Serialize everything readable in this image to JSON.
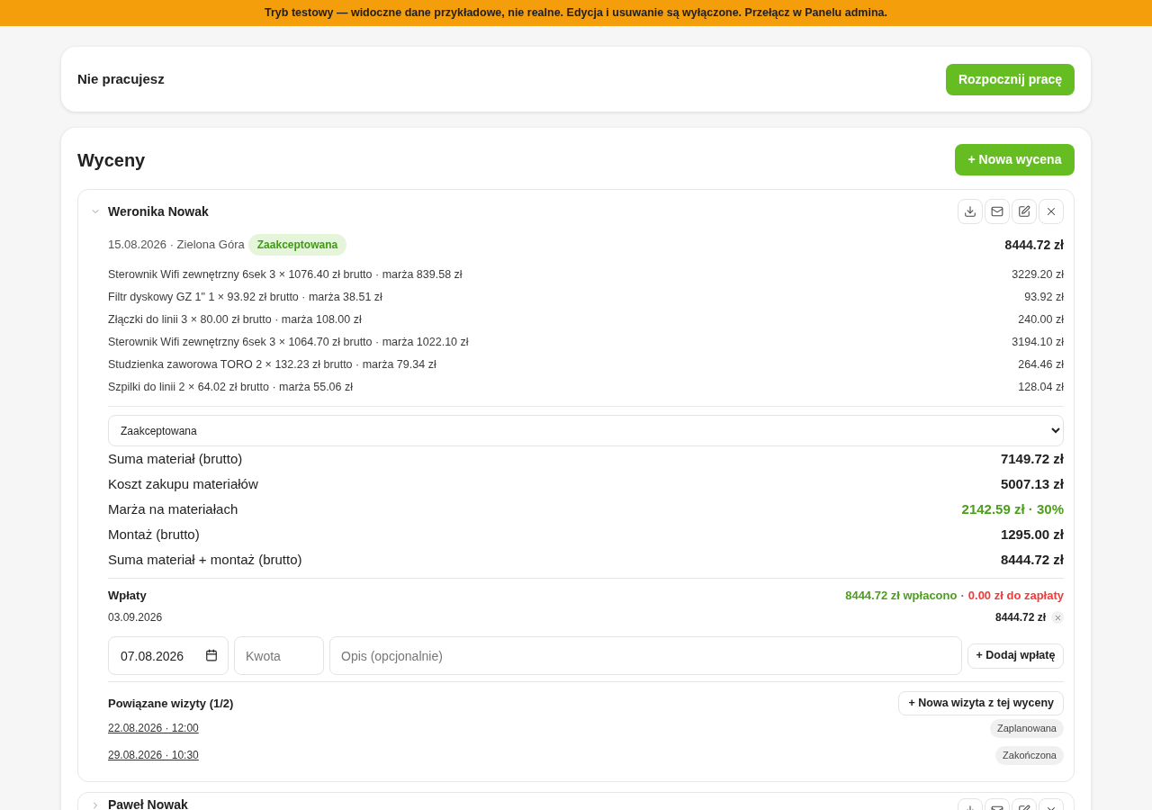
{
  "banner": {
    "text": "Tryb testowy — widoczne dane przykładowe, nie realne. Edycja i usuwanie są wyłączone. Przełącz w Panelu admina."
  },
  "work_status": {
    "label": "Nie pracujesz",
    "start_button": "Rozpocznij pracę"
  },
  "quotes_section": {
    "title": "Wyceny",
    "new_button": "+ Nowa wycena"
  },
  "quotes": [
    {
      "client": "Weronika Nowak",
      "expanded": true,
      "date_location": "15.08.2026 · Zielona Góra",
      "status_badge": {
        "text": "Zaakceptowana",
        "kind": "success"
      },
      "total": "8444.72 zł",
      "items": [
        {
          "description": "Sterownik Wifi zewnętrzny 6sek 3 × 1076.40 zł brutto · marża 839.58 zł",
          "amount": "3229.20 zł"
        },
        {
          "description": "Filtr dyskowy GZ 1\" 1 × 93.92 zł brutto · marża 38.51 zł",
          "amount": "93.92 zł"
        },
        {
          "description": "Złączki do linii 3 × 80.00 zł brutto · marża 108.00 zł",
          "amount": "240.00 zł"
        },
        {
          "description": "Sterownik Wifi zewnętrzny 6sek 3 × 1064.70 zł brutto · marża 1022.10 zł",
          "amount": "3194.10 zł"
        },
        {
          "description": "Studzienka zaworowa TORO 2 × 132.23 zł brutto · marża 79.34 zł",
          "amount": "264.46 zł"
        },
        {
          "description": "Szpilki do linii 2 × 64.02 zł brutto · marża 55.06 zł",
          "amount": "128.04 zł"
        }
      ],
      "status_select": {
        "value": "Zaakceptowana"
      },
      "summary": [
        {
          "label": "Suma materiał (brutto)",
          "value": "7149.72 zł",
          "kind": "plain"
        },
        {
          "label": "Koszt zakupu materiałów",
          "value": "5007.13 zł",
          "kind": "plain"
        },
        {
          "label": "Marża na materiałach",
          "value": "2142.59 zł · 30%",
          "kind": "positive"
        },
        {
          "label": "Montaż (brutto)",
          "value": "1295.00 zł",
          "kind": "plain"
        },
        {
          "label": "Suma materiał + montaż (brutto)",
          "value": "8444.72 zł",
          "kind": "plain"
        }
      ],
      "payments": {
        "title": "Wpłaty",
        "paid_text": "8444.72 zł wpłacono",
        "separator": "·",
        "due_text": "0.00 zł do zapłaty",
        "entries": [
          {
            "date": "03.09.2026",
            "amount": "8444.72 zł"
          }
        ],
        "form": {
          "date_value": "07.08.2026",
          "amount_placeholder": "Kwota",
          "description_placeholder": "Opis (opcjonalnie)",
          "add_button": "+ Dodaj wpłatę"
        }
      },
      "visits": {
        "title": "Powiązane wizyty (1/2)",
        "new_button": "+ Nowa wizyta z tej wyceny",
        "entries": [
          {
            "datetime": "22.08.2026 · 12:00",
            "status": "Zaplanowana"
          },
          {
            "datetime": "29.08.2026 · 10:30",
            "status": "Zakończona"
          }
        ]
      }
    },
    {
      "client": "Paweł Nowak",
      "expanded": false
    }
  ]
}
